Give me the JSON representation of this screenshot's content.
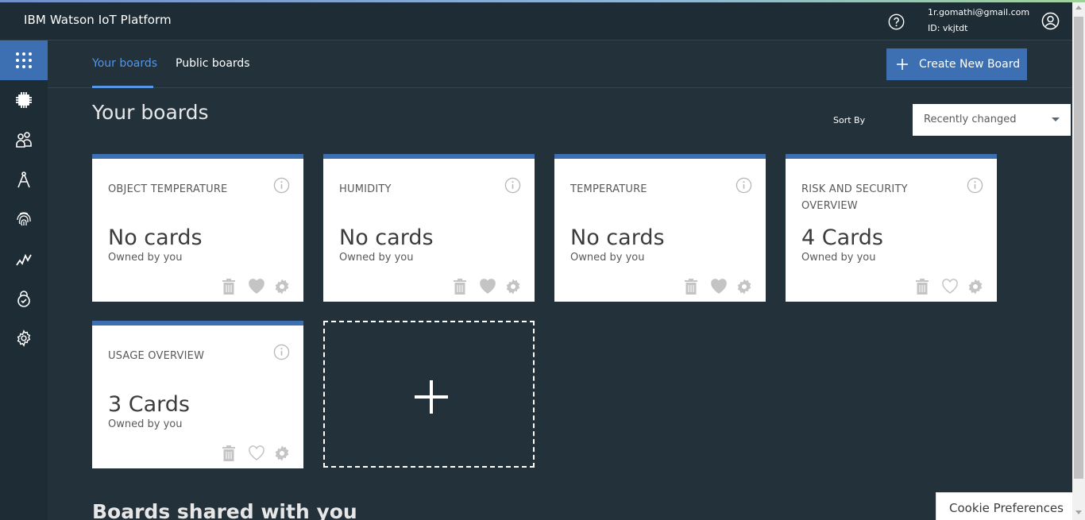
{
  "header": {
    "brand": "IBM Watson IoT Platform",
    "user_email": "1r.gomathi@gmail.com",
    "user_id": "ID: vkjtdt"
  },
  "sidebar": {
    "items": [
      {
        "icon": "grid-apps-icon",
        "active": true
      },
      {
        "icon": "chip-devices-icon",
        "active": false
      },
      {
        "icon": "members-icon",
        "active": false
      },
      {
        "icon": "compass-apps-icon",
        "active": false
      },
      {
        "icon": "fingerprint-icon",
        "active": false
      },
      {
        "icon": "analytics-trend-icon",
        "active": false
      },
      {
        "icon": "security-lock-icon",
        "active": false
      },
      {
        "icon": "settings-gear-icon",
        "active": false
      }
    ]
  },
  "tabs": [
    {
      "label": "Your boards",
      "active": true
    },
    {
      "label": "Public boards",
      "active": false
    }
  ],
  "create_button": "Create New Board",
  "page_title": "Your boards",
  "sort": {
    "label": "Sort By",
    "value": "Recently changed"
  },
  "boards": [
    {
      "title": "OBJECT TEMPERATURE",
      "count": "No cards",
      "owner": "Owned by you",
      "favorite": true
    },
    {
      "title": "HUMIDITY",
      "count": "No cards",
      "owner": "Owned by you",
      "favorite": true
    },
    {
      "title": "TEMPERATURE",
      "count": "No cards",
      "owner": "Owned by you",
      "favorite": true
    },
    {
      "title": "RISK AND SECURITY OVERVIEW",
      "count": "4 Cards",
      "owner": "Owned by you",
      "favorite": false
    },
    {
      "title": "USAGE OVERVIEW",
      "count": "3 Cards",
      "owner": "Owned by you",
      "favorite": false
    }
  ],
  "shared_title": "Boards shared with you",
  "cookie_button": "Cookie Preferences",
  "colors": {
    "accent": "#3d70b2",
    "background": "#22313a",
    "sidebar": "#1d2c35",
    "tab_active": "#5596e6"
  }
}
